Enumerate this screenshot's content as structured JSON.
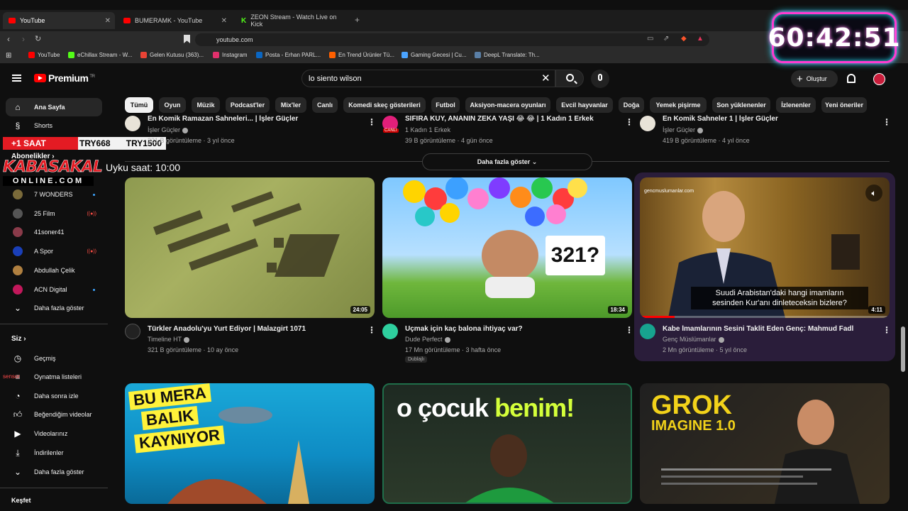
{
  "browser": {
    "tabs": [
      {
        "label": "YouTube",
        "active": true
      },
      {
        "label": "BUMERAMK - YouTube",
        "active": false
      },
      {
        "label": "ZEON Stream - Watch Live on Kick",
        "active": false
      }
    ],
    "url": "youtube.com",
    "bookmarks": [
      {
        "label": "YouTube",
        "color": "#ff0000"
      },
      {
        "label": "eChillax Stream - W...",
        "color": "#53fc18"
      },
      {
        "label": "Gelen Kutusu (363)...",
        "color": "#ea4335"
      },
      {
        "label": "Instagram",
        "color": "#e1306c"
      },
      {
        "label": "Posta - Erhan PARL...",
        "color": "#0a66c2"
      },
      {
        "label": "En Trend Ürünler Tü...",
        "color": "#ff6000"
      },
      {
        "label": "Gaming Gecesi | Cu...",
        "color": "#4aa3ff"
      },
      {
        "label": "DeepL Translate: Th...",
        "color": "#0f2b46"
      }
    ]
  },
  "timer": "60:42:51",
  "youtube": {
    "brand": "Premium",
    "brand_sup": "TR",
    "search_value": "lo siento wilson",
    "create_label": "Oluştur",
    "chips": [
      "Tümü",
      "Oyun",
      "Müzik",
      "Podcast'ler",
      "Mix'ler",
      "Canlı",
      "Komedi skeç gösterileri",
      "Futbol",
      "Aksiyon-macera oyunları",
      "Evcil hayvanlar",
      "Doğa",
      "Yemek pişirme",
      "Son yüklenenler",
      "İzlenenler",
      "Yeni öneriler"
    ]
  },
  "sidebar": {
    "home": "Ana Sayfa",
    "shorts": "Shorts",
    "subs_head": "Abonelikler",
    "channels": [
      {
        "name": "7 WONDERS",
        "color": "#7a6a3a",
        "live": false,
        "dot": true
      },
      {
        "name": "25 Film",
        "color": "#555555",
        "live": true,
        "dot": false
      },
      {
        "name": "41soner41",
        "color": "#8a3b4a",
        "live": false,
        "dot": false
      },
      {
        "name": "A Spor",
        "color": "#1a3fb8",
        "live": true,
        "dot": false
      },
      {
        "name": "Abdullah Çelik",
        "color": "#b08040",
        "live": false,
        "dot": false
      },
      {
        "name": "ACN Digital",
        "color": "#c2185b",
        "live": false,
        "dot": true
      }
    ],
    "more_subs": "Daha fazla göster",
    "you_head": "Siz",
    "you_items": [
      "Geçmiş",
      "Oynatma listeleri",
      "Daha sonra izle",
      "Beğendiğim videolar",
      "Videolarınız",
      "İndirilenler",
      "Daha fazla göster"
    ],
    "explore_head": "Keşfet"
  },
  "overlays": {
    "price_red": "+1 SAAT",
    "price_a": "TRY668",
    "price_b": "TRY1500",
    "kaba_top": "KABASAKAL",
    "kaba_bot": "ONLINE.COM",
    "sleep": "Uyku saat: 10:00",
    "sensor": "sensor"
  },
  "top_row": [
    {
      "title": "En Komik Ramazan Sahneleri... | İşler Güçler",
      "channel": "İşler Güçler",
      "meta": "321 B görüntüleme · 3 yıl önce"
    },
    {
      "title": "SIFIRA KUY, ANANIN ZEKA YAŞI 😂 😂 | 1 Kadın 1 Erkek",
      "channel": "1 Kadın 1 Erkek",
      "meta": "39 B görüntüleme · 4 gün önce",
      "badge": "CANLI"
    },
    {
      "title": "En Komik Sahneler 1 | İşler Güçler",
      "channel": "İşler Güçler",
      "meta": "419 B görüntüleme · 4 yıl önce"
    }
  ],
  "more_button": "Daha fazla göster",
  "videos": [
    {
      "title": "Türkler Anadolu'yu Yurt Ediyor | Malazgirt 1071",
      "channel": "Timeline HT",
      "meta": "321 B görüntüleme · 10 ay önce",
      "duration": "24:05"
    },
    {
      "title": "Uçmak için kaç balona ihtiyaç var?",
      "channel": "Dude Perfect",
      "meta": "17 Mn görüntüleme · 3 hafta önce",
      "duration": "18:34",
      "badge": "Dublajlı",
      "thumb_text": "321?"
    },
    {
      "title": "Kabe İmamlarının Sesini Taklit Eden Genç: Mahmud Fadl",
      "channel": "Genç Müslümanlar",
      "meta": "2 Mn görüntüleme · 5 yıl önce",
      "duration": "4:11",
      "thumb_site": "gencmuslumanlar.com",
      "subtitle1": "Suudi Arabistan'daki hangi imamların",
      "subtitle2": "sesinden Kur'anı dinleteceksin bizlere?"
    }
  ],
  "bottom_thumbs": [
    {
      "lines": [
        "BU MERA",
        "BALIK",
        "KAYNIYOR"
      ]
    },
    {
      "left": "o çocuk",
      "right": "benim!"
    },
    {
      "l1": "GROK",
      "l2": "IMAGINE 1.0"
    }
  ]
}
